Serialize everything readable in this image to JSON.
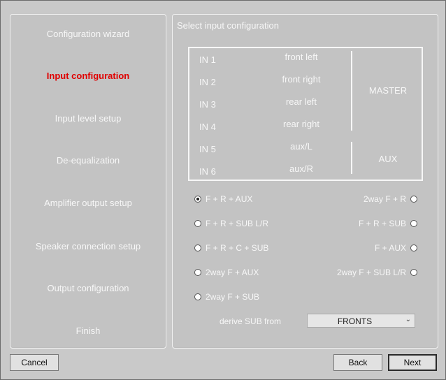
{
  "nav": {
    "items": [
      {
        "label": "Configuration wizard",
        "active": false
      },
      {
        "label": "Input configuration",
        "active": true
      },
      {
        "label": "Input level setup",
        "active": false
      },
      {
        "label": "De-equalization",
        "active": false
      },
      {
        "label": "Amplifier output setup",
        "active": false
      },
      {
        "label": "Speaker connection setup",
        "active": false
      },
      {
        "label": "Output configuration",
        "active": false
      },
      {
        "label": "Finish",
        "active": false
      }
    ]
  },
  "main": {
    "title": "Select input configuration",
    "inputs": [
      {
        "id": "IN 1",
        "desc": "front left"
      },
      {
        "id": "IN 2",
        "desc": "front right"
      },
      {
        "id": "IN 3",
        "desc": "rear left"
      },
      {
        "id": "IN 4",
        "desc": "rear right"
      },
      {
        "id": "IN 5",
        "desc": "aux/L"
      },
      {
        "id": "IN 6",
        "desc": "aux/R"
      }
    ],
    "groups": {
      "master": "MASTER",
      "aux": "AUX"
    },
    "options_left": [
      {
        "label": "F + R + AUX",
        "checked": true
      },
      {
        "label": "F + R + SUB L/R",
        "checked": false
      },
      {
        "label": "F + R + C + SUB",
        "checked": false
      },
      {
        "label": "2way F + AUX",
        "checked": false
      },
      {
        "label": "2way F + SUB",
        "checked": false
      }
    ],
    "options_right": [
      {
        "label": "2way F + R",
        "checked": false
      },
      {
        "label": "F + R + SUB",
        "checked": false
      },
      {
        "label": "F + AUX",
        "checked": false
      },
      {
        "label": "2way F + SUB L/R",
        "checked": false
      }
    ],
    "derive": {
      "label": "derive SUB from",
      "value": "FRONTS"
    }
  },
  "footer": {
    "cancel": "Cancel",
    "back": "Back",
    "next": "Next"
  }
}
